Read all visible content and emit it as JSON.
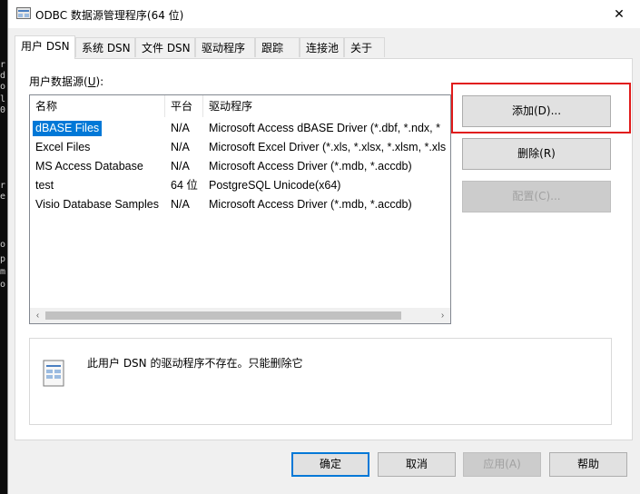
{
  "background_terminal": [
    "r",
    "d",
    "o",
    "l",
    "0",
    "r",
    "e",
    "o",
    "p",
    "m",
    "o"
  ],
  "window": {
    "title": "ODBC 数据源管理程序(64 位)",
    "close_glyph": "✕"
  },
  "tabs": [
    {
      "label": "用户 DSN",
      "active": true
    },
    {
      "label": "系统 DSN",
      "active": false
    },
    {
      "label": "文件 DSN",
      "active": false
    },
    {
      "label": "驱动程序",
      "active": false
    },
    {
      "label": "跟踪",
      "active": false
    },
    {
      "label": "连接池",
      "active": false
    },
    {
      "label": "关于",
      "active": false
    }
  ],
  "user_dsn": {
    "section_label": "用户数据源(U):",
    "columns": [
      "名称",
      "平台",
      "驱动程序"
    ],
    "rows": [
      {
        "name": "dBASE Files",
        "platform": "N/A",
        "driver": "Microsoft Access dBASE Driver (*.dbf, *.ndx, *",
        "selected": true
      },
      {
        "name": "Excel Files",
        "platform": "N/A",
        "driver": "Microsoft Excel Driver (*.xls, *.xlsx, *.xlsm, *.xls",
        "selected": false
      },
      {
        "name": "MS Access Database",
        "platform": "N/A",
        "driver": "Microsoft Access Driver (*.mdb, *.accdb)",
        "selected": false
      },
      {
        "name": "test",
        "platform": "64 位",
        "driver": "PostgreSQL Unicode(x64)",
        "selected": false
      },
      {
        "name": "Visio Database Samples",
        "platform": "N/A",
        "driver": "Microsoft Access Driver (*.mdb, *.accdb)",
        "selected": false
      }
    ],
    "scroll_left": "‹",
    "scroll_right": "›"
  },
  "side_buttons": {
    "add": "添加(D)...",
    "remove": "删除(R)",
    "configure": "配置(C)..."
  },
  "info": {
    "message": "此用户 DSN 的驱动程序不存在。只能删除它"
  },
  "bottom_buttons": {
    "ok": "确定",
    "cancel": "取消",
    "apply": "应用(A)",
    "help": "帮助"
  },
  "colors": {
    "selection": "#0078d7",
    "highlight": "#e11b1b"
  }
}
